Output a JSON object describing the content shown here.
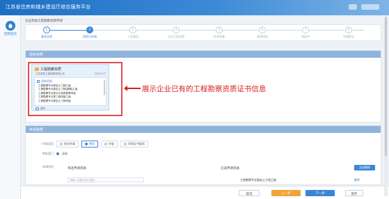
{
  "app": {
    "title": "江苏省住房和城乡建设厅综合服务平台"
  },
  "sidebar": {
    "home_label": "回到首页"
  },
  "breadcrumb": "企业资质工程勘察资质申请",
  "steps": [
    {
      "num": "1",
      "label": "基本信息",
      "state": "done"
    },
    {
      "num": "2",
      "label": "资质与申请",
      "state": "active"
    },
    {
      "num": "3",
      "label": "人员情况",
      "state": "todo"
    },
    {
      "num": "4",
      "label": "企业工程业绩",
      "state": "todo"
    },
    {
      "num": "5",
      "label": "技术装备",
      "state": "todo"
    },
    {
      "num": "6",
      "label": "其他材料",
      "state": "todo"
    },
    {
      "num": "7",
      "label": "承诺书",
      "state": "todo"
    },
    {
      "num": "8",
      "label": "申请提交",
      "state": "todo"
    }
  ],
  "qualification_panel": {
    "header": "现有资质",
    "card": {
      "title": "工程勘察资质",
      "subtitle": "江苏某某工程勘察有限公司",
      "date": "2019-9-27",
      "scope_header": "现有资质",
      "items": [
        "工程勘察专业类岩土工程乙级",
        "工程勘察专业类岩土工程(勘察)乙级",
        "工程勘察专业类水文地质勘察甲级",
        "工程勘察专业类工程测量乙级",
        "工程勘察专业类岩土工程丙级"
      ],
      "footer": "操作"
    }
  },
  "annotation": {
    "text": "展示企业已有的工程勘察资质证书信息",
    "color": "#d81e1e"
  },
  "apply_panel": {
    "header": "申请资质",
    "row1": {
      "label": "* 申请类型",
      "options": [
        "首次申请",
        "增项",
        "升级",
        "资质证书延续"
      ],
      "selected": 1
    },
    "row2": {
      "label": "审批部门",
      "value": "省级"
    },
    "row3": {
      "label": "申请资质"
    },
    "list_left_head": "单选申请资质",
    "list_right_head": "已选申请资质",
    "select_all_button": "全部删除",
    "search_placeholder": "请输入关键字进行搜索",
    "result_item": "工程勘察专业类岩土工程乙级",
    "result_action": "删除"
  },
  "buttons": {
    "cancel": "取消",
    "prev": "上一步",
    "next": "下一步",
    "save": "保存"
  },
  "colors": {
    "accent": "#3b86d4",
    "warn": "#f0a33a",
    "topbar": "#1d6fc4"
  }
}
